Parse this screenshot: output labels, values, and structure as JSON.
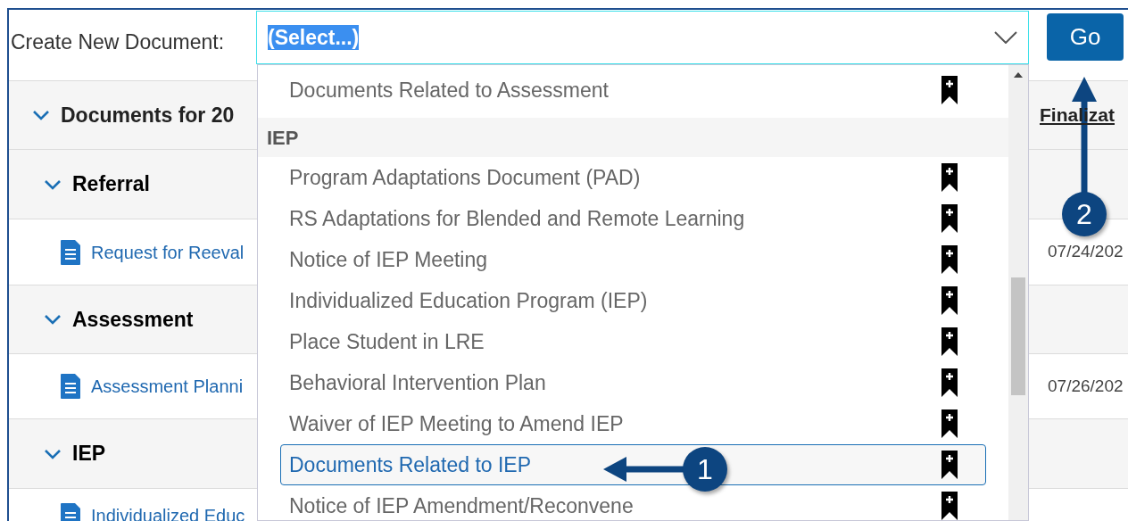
{
  "header": {
    "label": "Create New Document:",
    "select_value": "(Select...)",
    "go_button": "Go"
  },
  "table": {
    "title": "Documents for 20",
    "expanded": true,
    "column_2": "Finalizat",
    "rows": [
      {
        "kind": "group",
        "label": "Referral",
        "expanded": true
      },
      {
        "kind": "document",
        "label": "Request for Reeval",
        "date": "07/24/202"
      },
      {
        "kind": "group",
        "label": "Assessment",
        "expanded": true
      },
      {
        "kind": "document",
        "label": "Assessment Planni",
        "date": "07/26/202"
      },
      {
        "kind": "group",
        "label": "IEP",
        "expanded": true
      },
      {
        "kind": "document",
        "label": "Individualized Educ"
      }
    ]
  },
  "dropdown": {
    "items": [
      {
        "kind": "option",
        "label": "Documents Related to Assessment",
        "selected": false
      },
      {
        "kind": "group",
        "label": "IEP"
      },
      {
        "kind": "option",
        "label": "Program Adaptations Document (PAD)",
        "selected": false
      },
      {
        "kind": "option",
        "label": "RS Adaptations for Blended and Remote Learning",
        "selected": false
      },
      {
        "kind": "option",
        "label": "Notice of IEP Meeting",
        "selected": false
      },
      {
        "kind": "option",
        "label": "Individualized Education Program (IEP)",
        "selected": false
      },
      {
        "kind": "option",
        "label": "Place Student in LRE",
        "selected": false
      },
      {
        "kind": "option",
        "label": "Behavioral Intervention Plan",
        "selected": false
      },
      {
        "kind": "option",
        "label": "Waiver of IEP Meeting to Amend IEP",
        "selected": false
      },
      {
        "kind": "option",
        "label": "Documents Related to IEP",
        "selected": true
      },
      {
        "kind": "option",
        "label": "Notice of IEP Amendment/Reconvene",
        "selected": false
      }
    ]
  },
  "callouts": [
    {
      "label": "1"
    },
    {
      "label": "2"
    }
  ]
}
